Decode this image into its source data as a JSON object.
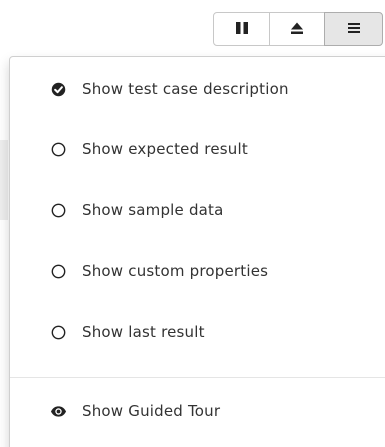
{
  "toolbar": {
    "buttons": [
      {
        "icon": "pause-icon"
      },
      {
        "icon": "eject-icon"
      },
      {
        "icon": "hamburger-menu-icon"
      }
    ]
  },
  "menu": {
    "items": [
      {
        "label": "Show test case description",
        "checked": true,
        "icon": "check-circle-icon"
      },
      {
        "label": "Show expected result",
        "checked": false,
        "icon": "radio-empty-icon"
      },
      {
        "label": "Show sample data",
        "checked": false,
        "icon": "radio-empty-icon"
      },
      {
        "label": "Show custom properties",
        "checked": false,
        "icon": "radio-empty-icon"
      },
      {
        "label": "Show last result",
        "checked": false,
        "icon": "radio-empty-icon"
      }
    ],
    "tour": {
      "label": "Show Guided Tour",
      "icon": "eye-icon"
    }
  },
  "colors": {
    "text": "#333333",
    "icon": "#222222",
    "border": "#c8c8c8",
    "active_button_bg": "#e6e6e6"
  }
}
